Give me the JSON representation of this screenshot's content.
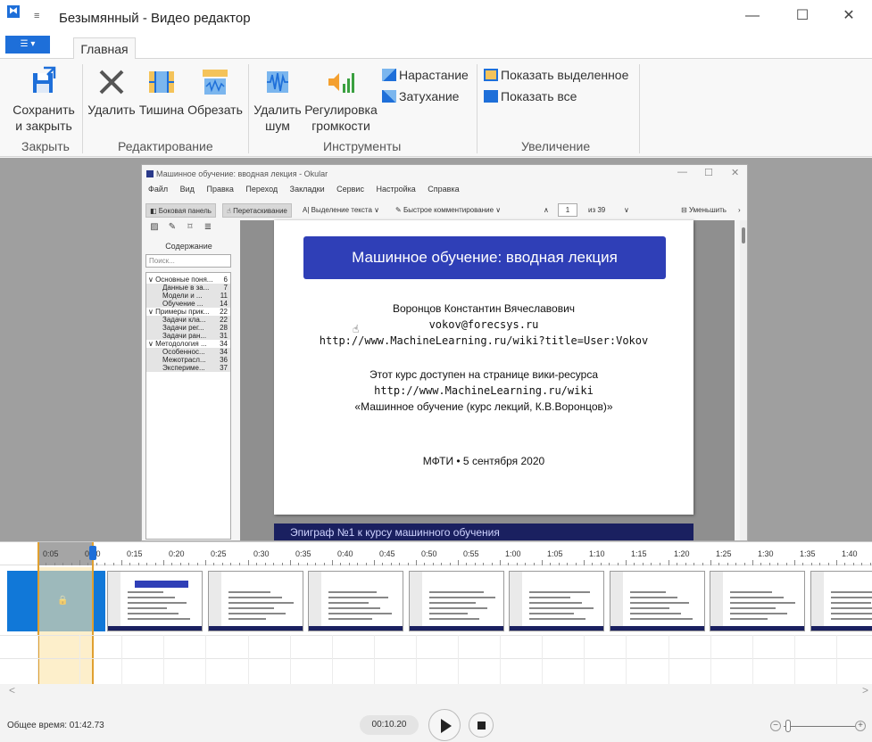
{
  "window": {
    "title": "Безымянный - Видео редактор",
    "app_icon": "video-editor-icon",
    "minimize": "—",
    "maximize": "☐",
    "close": "✕"
  },
  "ribbon": {
    "file_tab_label": "☰ ▾",
    "tabs": [
      {
        "label": "Главная"
      }
    ],
    "groups": [
      {
        "label": "Закрыть"
      },
      {
        "label": "Редактирование"
      },
      {
        "label": "Инструменты"
      },
      {
        "label": "Увеличение"
      }
    ],
    "save_close": {
      "line1": "Сохранить",
      "line2": "и закрыть"
    },
    "delete": {
      "label": "Удалить"
    },
    "silence": {
      "label": "Тишина"
    },
    "trim": {
      "label": "Обрезать"
    },
    "denoise": {
      "line1": "Удалить",
      "line2": "шум"
    },
    "volume": {
      "line1": "Регулировка",
      "line2": "громкости"
    },
    "fade_in": {
      "label": "Нарастание"
    },
    "fade_out": {
      "label": "Затухание"
    },
    "zoom_selection": {
      "label": "Показать выделенное"
    },
    "zoom_all": {
      "label": "Показать все"
    }
  },
  "okular": {
    "title": "Машинное обучение: вводная лекция - Okular",
    "menu": [
      "Файл",
      "Вид",
      "Правка",
      "Переход",
      "Закладки",
      "Сервис",
      "Настройка",
      "Справка"
    ],
    "toolbar": {
      "sidebar": "Боковая панель",
      "drag": "Перетаскивание",
      "text_select": "Выделение текста",
      "quick_annot": "Быстрое комментирование",
      "page_current": "1",
      "page_of": "из 39",
      "zoom_out": "Уменьшить"
    },
    "sidebar": {
      "heading": "Содержание",
      "search_placeholder": "Поиск...",
      "toc": [
        {
          "label": "∨ Основные поня...",
          "page": "6",
          "level": 0
        },
        {
          "label": "Данные в за...",
          "page": "7",
          "level": 1
        },
        {
          "label": "Модели и ...",
          "page": "11",
          "level": 1
        },
        {
          "label": "Обучение ...",
          "page": "14",
          "level": 1
        },
        {
          "label": "∨ Примеры прик...",
          "page": "22",
          "level": 0
        },
        {
          "label": "Задачи кла...",
          "page": "22",
          "level": 1
        },
        {
          "label": "Задачи рег...",
          "page": "28",
          "level": 1
        },
        {
          "label": "Задачи ран...",
          "page": "31",
          "level": 1
        },
        {
          "label": "∨ Методология ...",
          "page": "34",
          "level": 0
        },
        {
          "label": "Особеннос...",
          "page": "34",
          "level": 1
        },
        {
          "label": "Межотрасл...",
          "page": "36",
          "level": 1
        },
        {
          "label": "Экспериме...",
          "page": "37",
          "level": 1
        }
      ]
    },
    "slide": {
      "title": "Машинное обучение: вводная лекция",
      "author": "Воронцов Константин Вячеславович",
      "email": "vokov@forecsys.ru",
      "url": "http://www.MachineLearning.ru/wiki?title=User:Vokov",
      "avail": "Этот курс доступен на странице вики-ресурса",
      "wiki": "http://www.MachineLearning.ru/wiki",
      "course": "«Машинное обучение (курс лекций, К.В.Воронцов)»",
      "footer": "МФТИ  •  5 сентября 2020",
      "next_strip": "Эпиграф №1 к курсу машинного обучения"
    }
  },
  "timeline": {
    "ticks": [
      "0:05",
      "0:10",
      "0:15",
      "0:20",
      "0:25",
      "0:30",
      "0:35",
      "0:40",
      "0:45",
      "0:50",
      "0:55",
      "1:00",
      "1:05",
      "1:10",
      "1:15",
      "1:20",
      "1:25",
      "1:30",
      "1:35",
      "1:40"
    ],
    "lock_icon": "🔒",
    "scroll_left": "<",
    "scroll_right": ">"
  },
  "status": {
    "total_time": "Общее время: 01:42.73",
    "current_time": "00:10.20",
    "zoom_minus": "−",
    "zoom_plus": "+"
  },
  "colors": {
    "accent": "#1e6fd9",
    "slide_title_bg": "#2f3fb7",
    "selection": "#fce4a8"
  }
}
